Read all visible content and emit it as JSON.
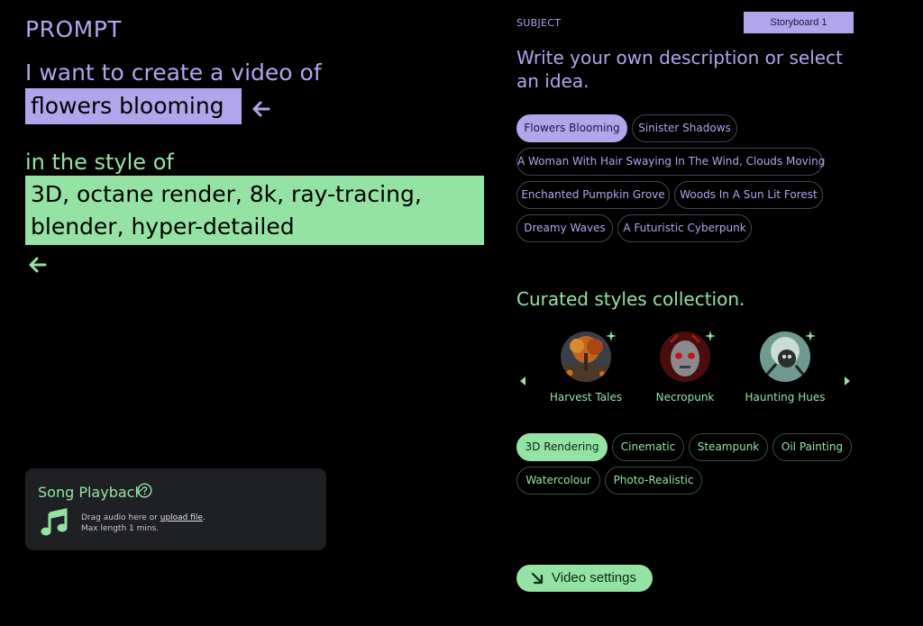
{
  "prompt": {
    "title": "PROMPT",
    "intro": "I want to create a video of",
    "subject_value": "flowers blooming",
    "style_intro": "in the style of",
    "style_value": "3D, octane render, 8k, ray-tracing, blender, hyper-detailed"
  },
  "song": {
    "title": "Song Playback",
    "drag_text": "Drag audio here or ",
    "upload_link": "upload file",
    "drag_suffix": ".",
    "max_length": "Max length 1 mins."
  },
  "subject": {
    "label": "SUBJECT",
    "storyboard_label": "Storyboard 1",
    "heading": "Write your own description or select an idea.",
    "ideas": [
      "Flowers Blooming",
      "Sinister Shadows",
      "A Woman With Hair Swaying In The Wind, Clouds Moving",
      "Enchanted Pumpkin Grove",
      "Woods In A Sun Lit Forest",
      "Dreamy Waves",
      "A Futuristic Cyberpunk"
    ],
    "selected_idea": "Flowers Blooming"
  },
  "styles": {
    "heading": "Curated styles collection.",
    "collections": [
      {
        "name": "Harvest Tales",
        "icon": "harvest-tales-thumbnail"
      },
      {
        "name": "Necropunk",
        "icon": "necropunk-thumbnail"
      },
      {
        "name": "Haunting Hues",
        "icon": "haunting-hues-thumbnail"
      }
    ],
    "tags": [
      "3D Rendering",
      "Cinematic",
      "Steampunk",
      "Oil Painting",
      "Watercolour",
      "Photo-Realistic"
    ],
    "selected_tag": "3D Rendering"
  },
  "actions": {
    "video_settings_label": "Video settings"
  },
  "colors": {
    "purple_accent": "#b1a6ec",
    "green_accent": "#94e3a4",
    "background": "#000000",
    "card": "#1f2023"
  }
}
